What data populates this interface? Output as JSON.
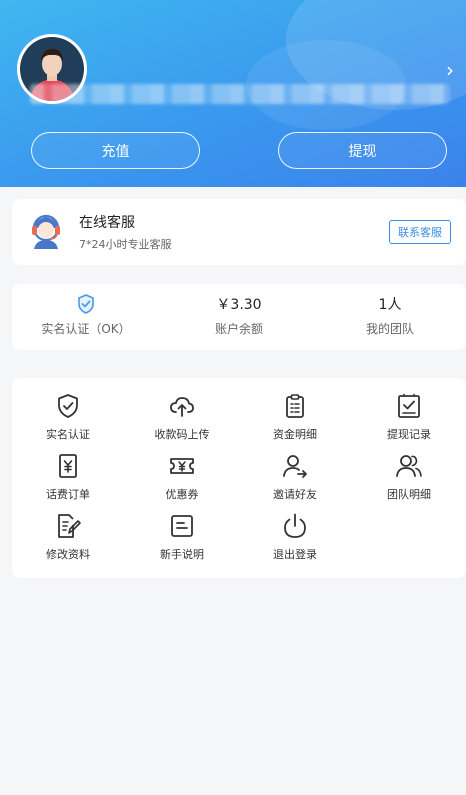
{
  "header": {
    "recharge_label": "充值",
    "withdraw_label": "提现"
  },
  "service": {
    "title": "在线客服",
    "subtitle": "7*24小时专业客服",
    "contact_label": "联系客服"
  },
  "stats": [
    {
      "value": "",
      "label": "实名认证（OK）"
    },
    {
      "value": "￥3.30",
      "label": "账户余额"
    },
    {
      "value": "1人",
      "label": "我的团队"
    }
  ],
  "menu": [
    {
      "label": "实名认证",
      "icon": "shield-check-icon"
    },
    {
      "label": "收款码上传",
      "icon": "cloud-upload-icon"
    },
    {
      "label": "资金明细",
      "icon": "clipboard-list-icon"
    },
    {
      "label": "提现记录",
      "icon": "clipboard-check-icon"
    },
    {
      "label": "话费订单",
      "icon": "yen-receipt-icon"
    },
    {
      "label": "优惠券",
      "icon": "coupon-icon"
    },
    {
      "label": "邀请好友",
      "icon": "invite-user-icon"
    },
    {
      "label": "团队明细",
      "icon": "team-icon"
    },
    {
      "label": "修改资料",
      "icon": "edit-document-icon"
    },
    {
      "label": "新手说明",
      "icon": "guide-document-icon"
    },
    {
      "label": "退出登录",
      "icon": "power-icon"
    }
  ],
  "colors": {
    "header_start": "#3fb7f0",
    "header_end": "#3b82ec",
    "accent": "#3a8ee6"
  }
}
